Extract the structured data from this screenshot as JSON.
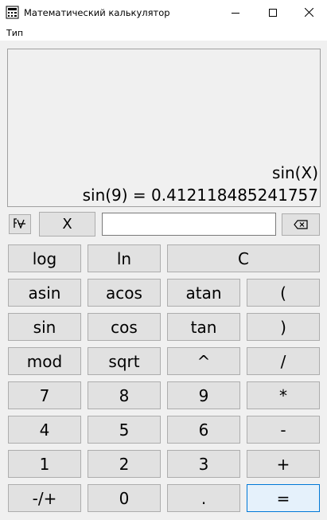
{
  "window": {
    "title": "Математический калькулятор",
    "icons": [
      "calculator-app-icon",
      "minimize-icon",
      "maximize-icon",
      "close-icon"
    ]
  },
  "menu": {
    "items": [
      "Тип"
    ]
  },
  "display": {
    "expression": "sin(X)",
    "result": "sin(9) = 0.412118485241757"
  },
  "input_row": {
    "function_toggle_icon": "function-graph-icon",
    "x_button": "X",
    "x_value": "",
    "backspace_icon": "backspace-icon"
  },
  "keys": [
    [
      "log",
      "ln",
      "C"
    ],
    [
      "asin",
      "acos",
      "atan",
      "("
    ],
    [
      "sin",
      "cos",
      "tan",
      ")"
    ],
    [
      "mod",
      "sqrt",
      "^",
      "/"
    ],
    [
      "7",
      "8",
      "9",
      "*"
    ],
    [
      "4",
      "5",
      "6",
      "-"
    ],
    [
      "1",
      "2",
      "3",
      "+"
    ],
    [
      "-/+",
      "0",
      ".",
      "="
    ]
  ],
  "colors": {
    "window_bg": "#f0f0f0",
    "button_bg": "#e1e1e1",
    "button_border": "#adadad",
    "equals_bg": "#e5f1fb",
    "equals_border": "#0078d7"
  }
}
